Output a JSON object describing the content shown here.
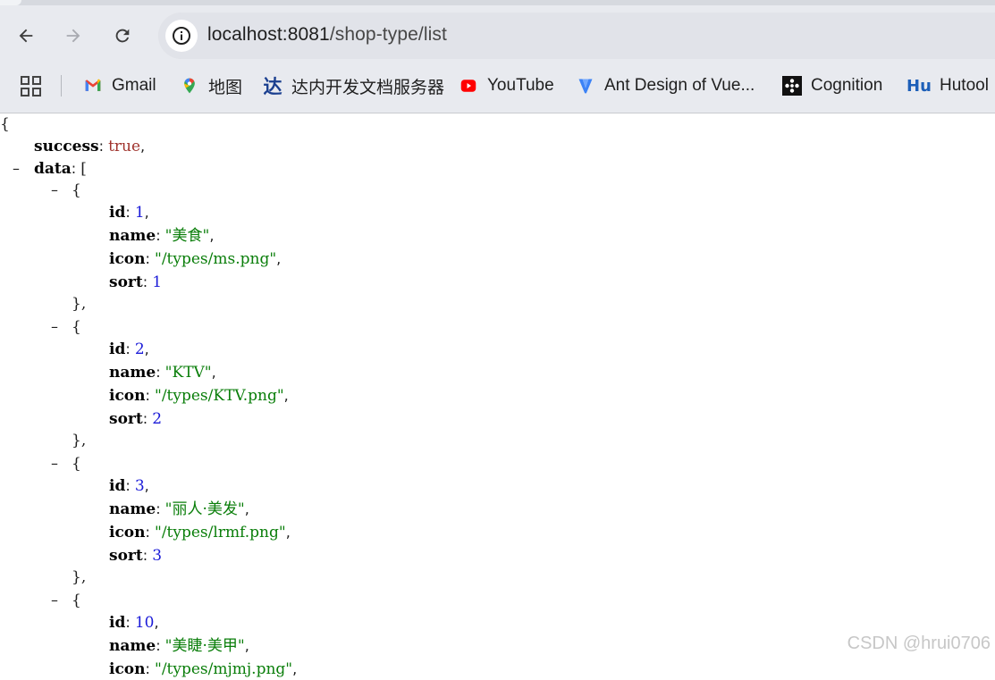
{
  "browser": {
    "url_host": "localhost:8081",
    "url_path": "/shop-type/list",
    "bookmarks": [
      {
        "label": "Gmail",
        "icon": "gmail-icon"
      },
      {
        "label": "地图",
        "icon": "maps-icon"
      },
      {
        "label": "达内开发文档服务器",
        "icon": "tarena-icon"
      },
      {
        "label": "YouTube",
        "icon": "youtube-icon"
      },
      {
        "label": "Ant Design of Vue...",
        "icon": "ant-design-icon"
      },
      {
        "label": "Cognition",
        "icon": "cognition-icon"
      },
      {
        "label": "Hutool",
        "icon": "hutool-icon"
      }
    ]
  },
  "json": {
    "open_brace": "{",
    "success_key": "success",
    "success_val": "true",
    "data_key": "data",
    "open_bracket": "[",
    "collapse": "–",
    "items": [
      {
        "id": "1",
        "name": "\"美食\"",
        "icon": "\"/types/ms.png\"",
        "sort": "1"
      },
      {
        "id": "2",
        "name": "\"KTV\"",
        "icon": "\"/types/KTV.png\"",
        "sort": "2"
      },
      {
        "id": "3",
        "name": "\"丽人·美发\"",
        "icon": "\"/types/lrmf.png\"",
        "sort": "3"
      },
      {
        "id": "10",
        "name": "\"美睫·美甲\"",
        "icon": "\"/types/mjmj.png\""
      }
    ],
    "keys": {
      "id": "id",
      "name": "name",
      "icon": "icon",
      "sort": "sort"
    }
  },
  "watermark": "CSDN @hrui0706",
  "colors": {
    "string": "#0a7e0a",
    "number": "#1b1bd8",
    "boolean": "#a0332d"
  }
}
